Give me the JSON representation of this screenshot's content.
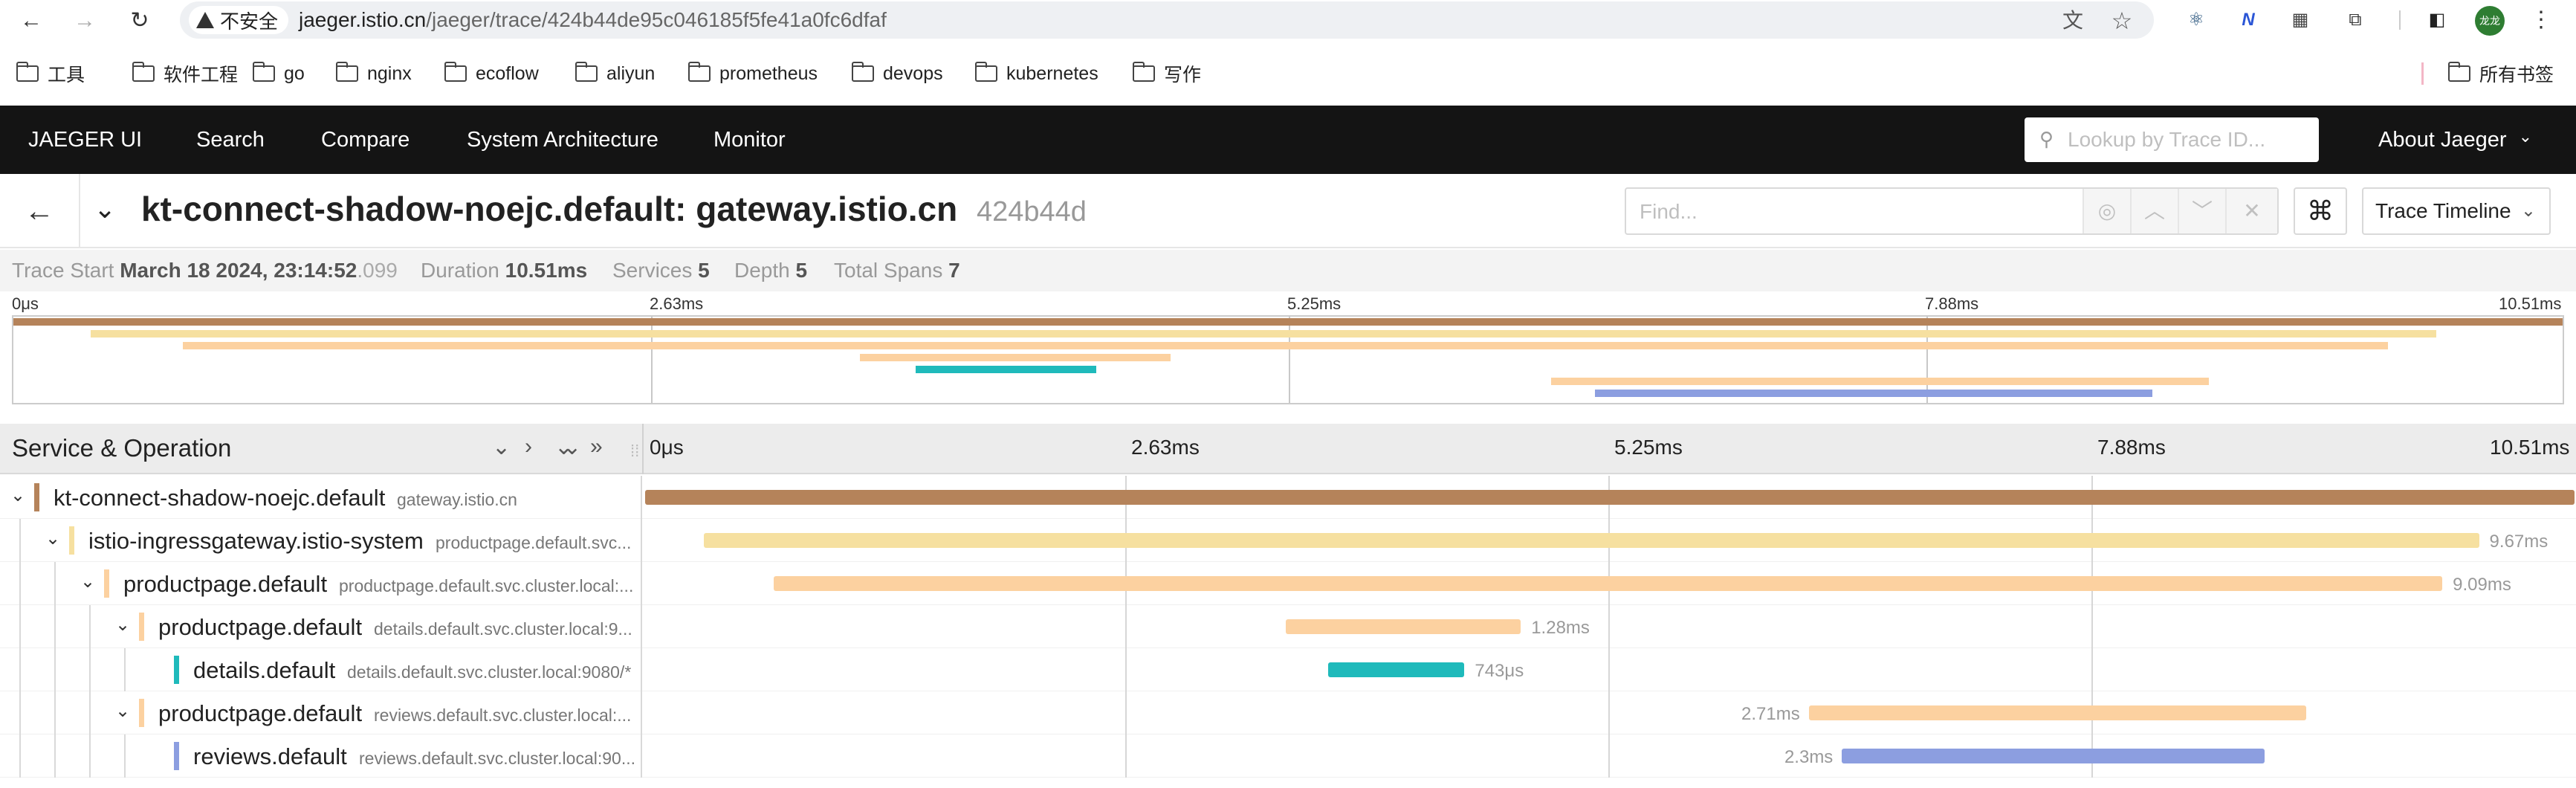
{
  "browser": {
    "back_glyph": "←",
    "forward_glyph": "→",
    "reload_glyph": "↻",
    "insecure_label": "不安全",
    "url_host": "jaeger.istio.cn",
    "url_path": "/jaeger/trace/424b44de95c046185f5fe41a0fc6dfaf",
    "translate_glyph": "文",
    "star_glyph": "☆",
    "ext_react_glyph": "⚛",
    "ext_n_glyph": "N",
    "ext_qr_glyph": "▦",
    "ext_puzzle_glyph": "⧉",
    "ext_panel_glyph": "◧",
    "avatar_text": "龙龙",
    "menu_glyph": "⋮"
  },
  "bookmarks": {
    "items": [
      "工具",
      "软件工程",
      "go",
      "nginx",
      "ecoflow",
      "aliyun",
      "prometheus",
      "devops",
      "kubernetes",
      "写作"
    ],
    "all_bookmarks": "所有书签"
  },
  "nav": {
    "brand": "JAEGER UI",
    "items": [
      "Search",
      "Compare",
      "System Architecture",
      "Monitor"
    ],
    "lookup_placeholder": "Lookup by Trace ID...",
    "about": "About Jaeger",
    "search_glyph": "⚲",
    "chevron_glyph": "⌄"
  },
  "trace": {
    "back_glyph": "←",
    "collapse_glyph": "⌄",
    "title": "kt-connect-shadow-noejc.default: gateway.istio.cn",
    "id_short": "424b44d",
    "find_placeholder": "Find...",
    "find_locate_glyph": "◎",
    "find_up_glyph": "︿",
    "find_down_glyph": "﹀",
    "find_clear_glyph": "✕",
    "keyboard_glyph": "⌘",
    "view_mode": "Trace Timeline",
    "view_chevron": "⌄"
  },
  "summary": {
    "start_label": "Trace Start",
    "start_value": "March 18 2024, 23:14:52",
    "start_ms": ".099",
    "duration_label": "Duration",
    "duration_value": "10.51ms",
    "services_label": "Services",
    "services_value": "5",
    "depth_label": "Depth",
    "depth_value": "5",
    "total_spans_label": "Total Spans",
    "total_spans_value": "7"
  },
  "minimap": {
    "ticks": [
      "0μs",
      "2.63ms",
      "5.25ms",
      "7.88ms",
      "10.51ms"
    ]
  },
  "spans_header": {
    "title": "Service & Operation",
    "ctrl_glyphs": [
      "⌄",
      "›",
      "⌄⌄",
      "»"
    ],
    "grip_glyph": "⁞⁞",
    "ticks": [
      "0μs",
      "2.63ms",
      "5.25ms",
      "7.88ms",
      "10.51ms"
    ]
  },
  "timeline": {
    "total_ms": 10.51
  },
  "spans": [
    {
      "service": "kt-connect-shadow-noejc.default",
      "operation": "gateway.istio.cn",
      "depth": 0,
      "color": "#b5835a",
      "start_ms": 0.0,
      "duration_ms": 10.51,
      "duration_label": "",
      "label_side": "none"
    },
    {
      "service": "istio-ingressgateway.istio-system",
      "operation": "productpage.default.svc...",
      "depth": 1,
      "color": "#f6e0a0",
      "start_ms": 0.32,
      "duration_ms": 9.67,
      "duration_label": "9.67ms",
      "label_side": "right"
    },
    {
      "service": "productpage.default",
      "operation": "productpage.default.svc.cluster.local:...",
      "depth": 2,
      "color": "#fcd1a0",
      "start_ms": 0.7,
      "duration_ms": 9.09,
      "duration_label": "9.09ms",
      "label_side": "right"
    },
    {
      "service": "productpage.default",
      "operation": "details.default.svc.cluster.local:9...",
      "depth": 3,
      "color": "#fcd1a0",
      "start_ms": 3.49,
      "duration_ms": 1.28,
      "duration_label": "1.28ms",
      "label_side": "right"
    },
    {
      "service": "details.default",
      "operation": "details.default.svc.cluster.local:9080/*",
      "depth": 4,
      "color": "#1fbabb",
      "start_ms": 3.72,
      "duration_ms": 0.743,
      "duration_label": "743μs",
      "label_side": "right"
    },
    {
      "service": "productpage.default",
      "operation": "reviews.default.svc.cluster.local:...",
      "depth": 3,
      "color": "#fcd1a0",
      "start_ms": 6.34,
      "duration_ms": 2.71,
      "duration_label": "2.71ms",
      "label_side": "left"
    },
    {
      "service": "reviews.default",
      "operation": "reviews.default.svc.cluster.local:90...",
      "depth": 4,
      "color": "#8c9ee0",
      "start_ms": 6.52,
      "duration_ms": 2.3,
      "duration_label": "2.3ms",
      "label_side": "left"
    }
  ]
}
